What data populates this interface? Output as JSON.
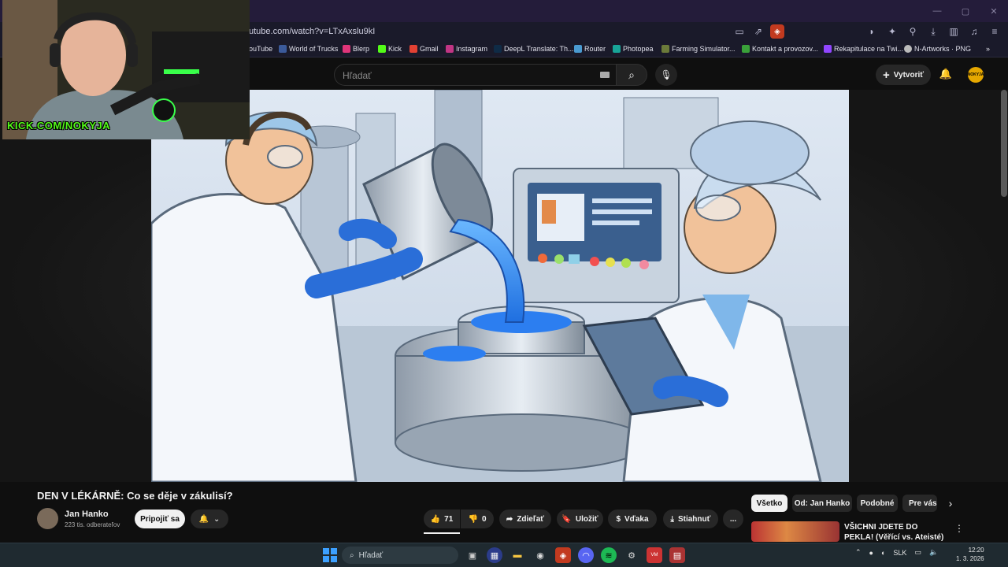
{
  "browser": {
    "url": "utube.com/watch?v=LTxAxslu9kI",
    "bookmarks": [
      "ouTube",
      "World of Trucks",
      "Blerp",
      "Kick",
      "Gmail",
      "Instagram",
      "DeepL Translate: Th...",
      "Router",
      "Photopea",
      "Farming Simulator...",
      "Kontakt a provozov...",
      "Rekapitulace na Twi...",
      "N-Artworks · PNG"
    ],
    "more": "»"
  },
  "youtube": {
    "search_placeholder": "Hľadať",
    "create_label": "Vytvoriť",
    "avatar_text": "NOKYJA"
  },
  "webcam": {
    "overlay_text": "KICK.COM/NOKYJA"
  },
  "video": {
    "title": "DEN V LÉKÁRNĚ: Co se děje v zákulisí?",
    "channel_name": "Jan Hanko",
    "subscribers": "223 tis. odberateľov",
    "subscribe_label": "Pripojiť sa",
    "likes": "71",
    "dislikes": "0",
    "share_label": "Zdieľať",
    "save_label": "Uložiť",
    "thanks_label": "Vďaka",
    "download_label": "Stiahnuť",
    "more_label": "..."
  },
  "chips": [
    "Všetko",
    "Od: Jan Hanko",
    "Podobné",
    "Pre vás"
  ],
  "recommended": {
    "title": "VŠICHNI JDETE DO PEKLA! (Věřící vs. Ateisté)"
  },
  "taskbar": {
    "search_label": "Hľadať",
    "language": "SLK",
    "time": "12:20",
    "date": "1. 3. 2026"
  }
}
